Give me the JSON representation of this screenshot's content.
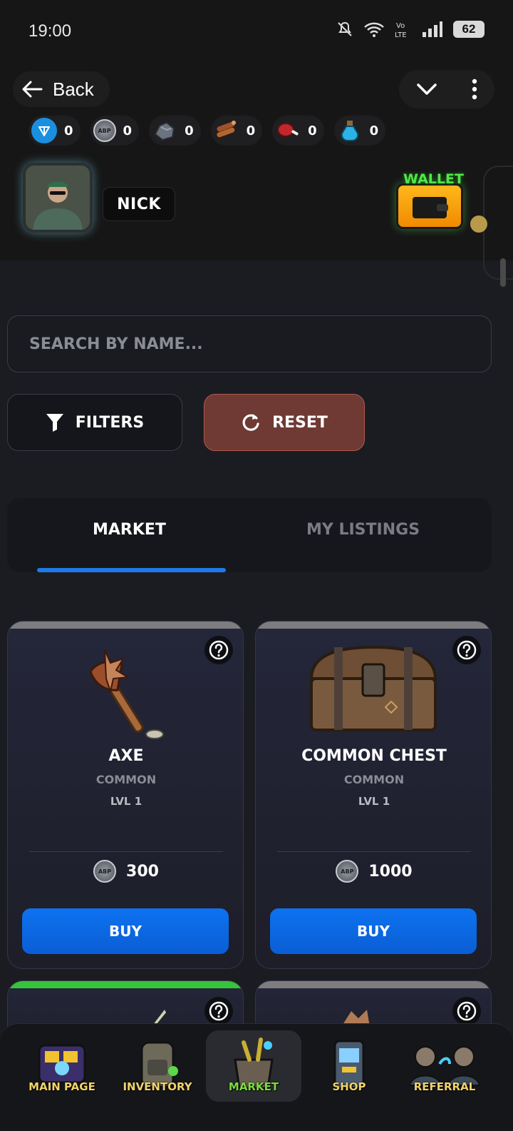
{
  "status_bar": {
    "time": "19:00",
    "battery": "62"
  },
  "header": {
    "back_label": "Back"
  },
  "resources": [
    {
      "icon": "ton-icon",
      "value": "0"
    },
    {
      "icon": "abp-coin-icon",
      "value": "0"
    },
    {
      "icon": "stone-icon",
      "value": "0"
    },
    {
      "icon": "wood-icon",
      "value": "0"
    },
    {
      "icon": "meat-icon",
      "value": "0"
    },
    {
      "icon": "potion-icon",
      "value": "0"
    }
  ],
  "profile": {
    "name": "NICK",
    "wallet_label": "WALLET"
  },
  "search": {
    "placeholder": "SEARCH BY NAME..."
  },
  "actions": {
    "filters_label": "FILTERS",
    "reset_label": "RESET"
  },
  "tabs": {
    "market": "MARKET",
    "my_listings": "MY LISTINGS",
    "active": "MARKET"
  },
  "cards": [
    {
      "title": "AXE",
      "rarity": "COMMON",
      "level": "LVL 1",
      "price": "300",
      "buy_label": "BUY"
    },
    {
      "title": "COMMON CHEST",
      "rarity": "COMMON",
      "level": "LVL 1",
      "price": "1000",
      "buy_label": "BUY"
    }
  ],
  "bottom_nav": [
    {
      "label": "MAIN PAGE",
      "active": false
    },
    {
      "label": "INVENTORY",
      "active": false
    },
    {
      "label": "MARKET",
      "active": true
    },
    {
      "label": "SHOP",
      "active": false
    },
    {
      "label": "REFERRAL",
      "active": false
    }
  ],
  "colors": {
    "accent_blue": "#1e7ae8",
    "buy_blue": "#0a66e0",
    "reset_red": "#6e3a33",
    "wallet_green": "#52e64a"
  }
}
